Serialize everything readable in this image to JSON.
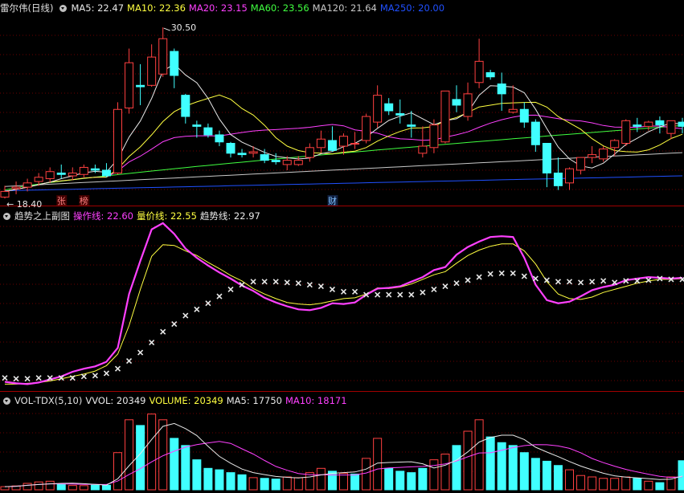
{
  "colors": {
    "up": "#ff4040",
    "down": "#40ffff",
    "bg": "#000000",
    "grid": "#6b0000",
    "white": "#e8e8e8",
    "yellow": "#ffff40",
    "magenta": "#ff40ff",
    "green": "#40ff40",
    "gray": "#c8c8c8",
    "blue": "#2050ff"
  },
  "main": {
    "title": "雷尔伟(日线)",
    "indicators": [
      {
        "label": "MA5: 22.47",
        "color": "#e8e8e8"
      },
      {
        "label": "MA10: 22.36",
        "color": "#ffff40"
      },
      {
        "label": "MA20: 23.15",
        "color": "#ff40ff"
      },
      {
        "label": "MA60: 23.56",
        "color": "#40ff40"
      },
      {
        "label": "MA120: 21.64",
        "color": "#c8c8c8"
      },
      {
        "label": "MA250: 20.00",
        "color": "#2050ff"
      }
    ],
    "high_label": "30.50",
    "low_label": "18.40",
    "markers": [
      {
        "text": "张",
        "index": 5
      },
      {
        "text": "榜",
        "index": 7
      },
      {
        "text": "财",
        "index": 29
      }
    ]
  },
  "sub": {
    "title": "趋势之上副图",
    "indicators": [
      {
        "label": "操作线: 22.60",
        "color": "#ff40ff"
      },
      {
        "label": "量价线: 22.55",
        "color": "#ffff40"
      },
      {
        "label": "趋势线: 22.97",
        "color": "#e8e8e8"
      }
    ]
  },
  "vol": {
    "title": "VOL-TDX(5,10)",
    "indicators": [
      {
        "label": "VVOL: 20349",
        "color": "#e8e8e8"
      },
      {
        "label": "VOLUME: 20349",
        "color": "#ffff40"
      },
      {
        "label": "MA5: 17750",
        "color": "#e8e8e8"
      },
      {
        "label": "MA10: 18171",
        "color": "#ff40ff"
      }
    ]
  },
  "chart_data": [
    {
      "type": "candlestick",
      "name": "main",
      "ylim": [
        17.9,
        31.3
      ],
      "ohlc": [
        [
          18.5,
          19.3,
          18.4,
          18.9
        ],
        [
          19.1,
          19.6,
          18.7,
          19.2
        ],
        [
          19.2,
          19.8,
          18.9,
          19.5
        ],
        [
          19.6,
          20.2,
          19.3,
          19.9
        ],
        [
          19.8,
          20.6,
          19.5,
          20.3
        ],
        [
          20.2,
          20.8,
          19.8,
          20.1
        ],
        [
          20.0,
          20.6,
          19.7,
          20.2
        ],
        [
          20.1,
          20.8,
          19.9,
          20.6
        ],
        [
          20.5,
          20.8,
          20.2,
          20.4
        ],
        [
          20.4,
          20.9,
          19.9,
          20.0
        ],
        [
          20.2,
          25.2,
          20.1,
          24.7
        ],
        [
          24.8,
          29.0,
          24.4,
          28.0
        ],
        [
          26.4,
          27.9,
          25.0,
          26.3
        ],
        [
          26.4,
          29.3,
          26.3,
          28.4
        ],
        [
          27.2,
          30.5,
          27.0,
          29.7
        ],
        [
          28.8,
          29.0,
          26.2,
          27.1
        ],
        [
          25.7,
          25.8,
          23.7,
          24.2
        ],
        [
          23.6,
          23.9,
          22.7,
          23.5
        ],
        [
          23.4,
          23.7,
          22.7,
          22.9
        ],
        [
          22.9,
          23.2,
          22.1,
          22.4
        ],
        [
          22.3,
          22.4,
          21.3,
          21.6
        ],
        [
          21.6,
          21.9,
          21.3,
          21.5
        ],
        [
          21.6,
          22.1,
          21.3,
          21.7
        ],
        [
          21.5,
          21.9,
          20.9,
          21.1
        ],
        [
          21.1,
          21.6,
          20.8,
          21.0
        ],
        [
          20.8,
          21.4,
          20.4,
          21.1
        ],
        [
          20.8,
          21.4,
          20.7,
          21.1
        ],
        [
          21.3,
          22.3,
          21.0,
          22.0
        ],
        [
          22.0,
          23.2,
          21.6,
          22.6
        ],
        [
          22.5,
          23.5,
          21.7,
          21.8
        ],
        [
          22.1,
          23.0,
          21.5,
          22.8
        ],
        [
          22.3,
          23.1,
          21.9,
          22.3
        ],
        [
          22.5,
          24.4,
          22.3,
          24.2
        ],
        [
          23.8,
          26.4,
          23.4,
          25.7
        ],
        [
          25.1,
          25.5,
          24.3,
          24.6
        ],
        [
          24.4,
          25.4,
          23.7,
          24.3
        ],
        [
          23.6,
          24.6,
          22.7,
          23.5
        ],
        [
          21.6,
          23.5,
          21.3,
          22.1
        ],
        [
          22.0,
          24.0,
          21.6,
          23.6
        ],
        [
          22.4,
          26.0,
          22.3,
          26.0
        ],
        [
          25.4,
          26.4,
          24.5,
          25.0
        ],
        [
          24.2,
          26.6,
          23.9,
          25.8
        ],
        [
          26.6,
          29.7,
          26.2,
          28.1
        ],
        [
          27.3,
          27.5,
          26.8,
          27.0
        ],
        [
          26.5,
          27.3,
          24.6,
          25.8
        ],
        [
          24.5,
          26.4,
          24.4,
          24.7
        ],
        [
          24.7,
          25.2,
          23.4,
          23.8
        ],
        [
          23.8,
          24.0,
          21.7,
          22.2
        ],
        [
          22.3,
          22.3,
          19.2,
          20.2
        ],
        [
          20.2,
          21.3,
          19.0,
          19.3
        ],
        [
          19.5,
          20.6,
          19.0,
          20.5
        ],
        [
          20.4,
          21.3,
          20.1,
          21.3
        ],
        [
          21.3,
          22.1,
          20.9,
          21.5
        ],
        [
          21.2,
          22.1,
          21.0,
          21.9
        ],
        [
          22.0,
          22.6,
          21.4,
          22.5
        ],
        [
          22.3,
          24.0,
          22.1,
          23.9
        ],
        [
          23.6,
          24.1,
          23.1,
          23.5
        ],
        [
          23.5,
          23.9,
          23.2,
          23.8
        ],
        [
          23.9,
          24.2,
          23.0,
          23.6
        ],
        [
          23.0,
          23.9,
          22.6,
          23.9
        ],
        [
          23.8,
          24.1,
          23.0,
          23.5
        ]
      ]
    },
    {
      "type": "line",
      "name": "sub",
      "ylim": [
        8,
        30
      ],
      "series": [
        {
          "name": "操作线",
          "values": [
            9.2,
            9.0,
            8.9,
            9.1,
            9.5,
            9.9,
            10.5,
            10.9,
            11.2,
            11.8,
            13.6,
            20.6,
            24.9,
            29.0,
            29.8,
            28.4,
            26.5,
            25.3,
            24.3,
            23.4,
            22.6,
            21.7,
            21.0,
            20.1,
            19.5,
            19.0,
            18.6,
            18.5,
            18.8,
            19.4,
            19.3,
            19.5,
            20.5,
            21.3,
            21.4,
            21.6,
            22.2,
            22.8,
            23.7,
            24.1,
            25.7,
            26.7,
            27.4,
            28.0,
            28.1,
            28.0,
            25.3,
            21.8,
            19.8,
            19.4,
            19.6,
            20.3,
            21.1,
            21.5,
            21.8,
            22.4,
            22.6,
            22.8,
            22.7,
            22.6,
            22.7
          ]
        },
        {
          "name": "量价线",
          "values": [
            8.9,
            8.9,
            9.0,
            9.1,
            9.3,
            9.6,
            9.9,
            10.2,
            10.6,
            11.3,
            12.8,
            16.5,
            21.2,
            25.5,
            27.0,
            26.9,
            26.2,
            25.6,
            24.7,
            23.9,
            23.0,
            22.3,
            21.3,
            20.6,
            20.0,
            19.5,
            19.3,
            19.2,
            19.4,
            19.7,
            20.0,
            20.1,
            20.6,
            21.4,
            21.3,
            21.5,
            21.9,
            22.5,
            23.1,
            23.5,
            24.6,
            25.6,
            26.3,
            26.8,
            27.1,
            27.1,
            26.2,
            24.5,
            22.2,
            20.6,
            20.0,
            19.9,
            20.2,
            20.8,
            21.2,
            21.6,
            22.0,
            22.3,
            22.5,
            22.5,
            22.6
          ]
        },
        {
          "name": "趋势线",
          "values": [
            9.7,
            9.6,
            9.6,
            9.7,
            9.7,
            9.7,
            9.7,
            9.9,
            10.0,
            10.3,
            10.9,
            11.9,
            13.0,
            14.3,
            15.7,
            16.7,
            17.8,
            18.6,
            19.4,
            20.3,
            21.2,
            21.8,
            22.2,
            22.2,
            22.2,
            22.1,
            22.0,
            21.8,
            21.6,
            21.2,
            20.9,
            20.9,
            20.5,
            20.5,
            20.5,
            20.5,
            20.5,
            20.8,
            21.2,
            21.6,
            22.0,
            22.4,
            22.8,
            23.2,
            23.3,
            23.3,
            22.9,
            22.6,
            22.4,
            22.2,
            22.2,
            22.1,
            22.2,
            22.3,
            22.1,
            22.3,
            22.3,
            22.4,
            22.6,
            22.5,
            22.5
          ]
        }
      ]
    },
    {
      "type": "bar",
      "name": "vol",
      "ylim": [
        0,
        59000
      ],
      "values": [
        2200,
        2700,
        4500,
        5500,
        6000,
        3900,
        3000,
        2900,
        3300,
        3200,
        26000,
        49000,
        45000,
        53000,
        49000,
        36000,
        31000,
        21000,
        15000,
        14000,
        12000,
        10500,
        8500,
        8000,
        7500,
        9000,
        8500,
        12000,
        15000,
        13000,
        11500,
        11000,
        22000,
        36000,
        15000,
        13000,
        12000,
        15000,
        21000,
        25000,
        31000,
        41000,
        49000,
        37000,
        33000,
        31000,
        26000,
        22000,
        20000,
        17000,
        14000,
        10000,
        9000,
        8000,
        8000,
        9000,
        8000,
        6000,
        5000,
        9000,
        20349
      ],
      "up": [
        1,
        1,
        1,
        1,
        1,
        0,
        1,
        1,
        0,
        0,
        1,
        1,
        0,
        1,
        1,
        0,
        0,
        0,
        0,
        0,
        0,
        0,
        1,
        0,
        0,
        1,
        1,
        1,
        1,
        0,
        1,
        0,
        1,
        1,
        0,
        0,
        0,
        0,
        1,
        1,
        0,
        1,
        1,
        0,
        0,
        0,
        0,
        0,
        0,
        0,
        1,
        1,
        1,
        1,
        1,
        1,
        0,
        1,
        0,
        1,
        0
      ]
    }
  ]
}
